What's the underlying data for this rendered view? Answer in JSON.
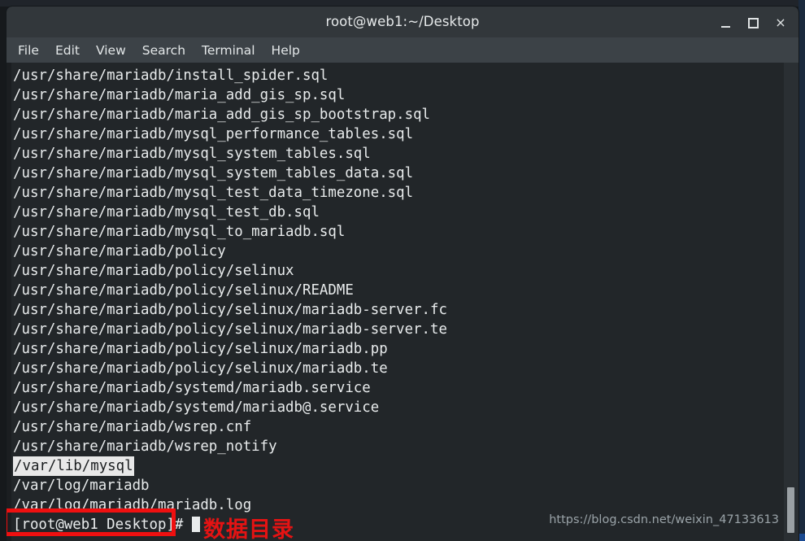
{
  "window": {
    "title": "root@web1:~/Desktop",
    "controls": {
      "minimize": "_",
      "maximize": "□",
      "close": "×"
    }
  },
  "menubar": {
    "items": [
      {
        "label": "File"
      },
      {
        "label": "Edit"
      },
      {
        "label": "View"
      },
      {
        "label": "Search"
      },
      {
        "label": "Terminal"
      },
      {
        "label": "Help"
      }
    ]
  },
  "terminal": {
    "lines": [
      {
        "text": "/usr/share/mariadb/install_spider.sql",
        "selected": false
      },
      {
        "text": "/usr/share/mariadb/maria_add_gis_sp.sql",
        "selected": false
      },
      {
        "text": "/usr/share/mariadb/maria_add_gis_sp_bootstrap.sql",
        "selected": false
      },
      {
        "text": "/usr/share/mariadb/mysql_performance_tables.sql",
        "selected": false
      },
      {
        "text": "/usr/share/mariadb/mysql_system_tables.sql",
        "selected": false
      },
      {
        "text": "/usr/share/mariadb/mysql_system_tables_data.sql",
        "selected": false
      },
      {
        "text": "/usr/share/mariadb/mysql_test_data_timezone.sql",
        "selected": false
      },
      {
        "text": "/usr/share/mariadb/mysql_test_db.sql",
        "selected": false
      },
      {
        "text": "/usr/share/mariadb/mysql_to_mariadb.sql",
        "selected": false
      },
      {
        "text": "/usr/share/mariadb/policy",
        "selected": false
      },
      {
        "text": "/usr/share/mariadb/policy/selinux",
        "selected": false
      },
      {
        "text": "/usr/share/mariadb/policy/selinux/README",
        "selected": false
      },
      {
        "text": "/usr/share/mariadb/policy/selinux/mariadb-server.fc",
        "selected": false
      },
      {
        "text": "/usr/share/mariadb/policy/selinux/mariadb-server.te",
        "selected": false
      },
      {
        "text": "/usr/share/mariadb/policy/selinux/mariadb.pp",
        "selected": false
      },
      {
        "text": "/usr/share/mariadb/policy/selinux/mariadb.te",
        "selected": false
      },
      {
        "text": "/usr/share/mariadb/systemd/mariadb.service",
        "selected": false
      },
      {
        "text": "/usr/share/mariadb/systemd/mariadb@.service",
        "selected": false
      },
      {
        "text": "/usr/share/mariadb/wsrep.cnf",
        "selected": false
      },
      {
        "text": "/usr/share/mariadb/wsrep_notify",
        "selected": false
      },
      {
        "text": "/var/lib/mysql",
        "selected": true
      },
      {
        "text": "/var/log/mariadb",
        "selected": false
      },
      {
        "text": "/var/log/mariadb/mariadb.log",
        "selected": false
      }
    ],
    "prompt": "[root@web1 Desktop]# ",
    "scrollbar": {
      "position": "bottom"
    }
  },
  "annotation": {
    "label": "数据目录",
    "color": "#e41313",
    "target_line": "/var/lib/mysql"
  },
  "watermark": {
    "text": "https://blog.csdn.net/weixin_47133613"
  },
  "colors": {
    "titlebar": "#32373b",
    "menubar": "#3c4247",
    "terminal_bg": "#222629",
    "terminal_fg": "#e8ebec",
    "selection_bg": "#e8e8e8",
    "annotation_red": "#ef1010",
    "taskbar_accent": "#1b4a91"
  }
}
